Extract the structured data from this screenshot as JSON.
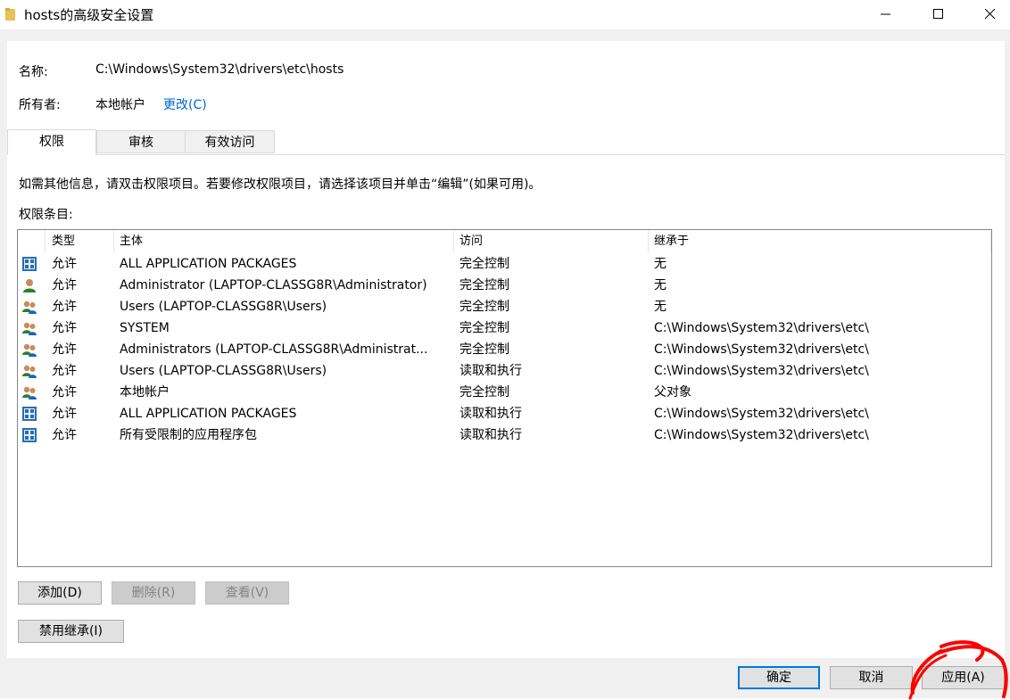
{
  "window": {
    "title": "hosts的高级安全设置"
  },
  "name_label": "名称:",
  "name_value": "C:\\Windows\\System32\\drivers\\etc\\hosts",
  "owner_label": "所有者:",
  "owner_value": "本地帐户",
  "owner_change": "更改(C)",
  "tabs": [
    "权限",
    "审核",
    "有效访问"
  ],
  "info_text": "如需其他信息，请双击权限项目。若要修改权限项目，请选择该项目并单击“编辑”(如果可用)。",
  "entries_label": "权限条目:",
  "columns": [
    "类型",
    "主体",
    "访问",
    "继承于"
  ],
  "rows": [
    {
      "icon": "app-package-icon",
      "type": "允许",
      "principal": "ALL APPLICATION PACKAGES",
      "access": "完全控制",
      "inherited": "无"
    },
    {
      "icon": "user-icon",
      "type": "允许",
      "principal": "Administrator (LAPTOP-CLASSG8R\\Administrator)",
      "access": "完全控制",
      "inherited": "无"
    },
    {
      "icon": "group-icon",
      "type": "允许",
      "principal": "Users (LAPTOP-CLASSG8R\\Users)",
      "access": "完全控制",
      "inherited": "无"
    },
    {
      "icon": "group-icon",
      "type": "允许",
      "principal": "SYSTEM",
      "access": "完全控制",
      "inherited": "C:\\Windows\\System32\\drivers\\etc\\"
    },
    {
      "icon": "group-icon",
      "type": "允许",
      "principal": "Administrators (LAPTOP-CLASSG8R\\Administrat...",
      "access": "完全控制",
      "inherited": "C:\\Windows\\System32\\drivers\\etc\\"
    },
    {
      "icon": "group-icon",
      "type": "允许",
      "principal": "Users (LAPTOP-CLASSG8R\\Users)",
      "access": "读取和执行",
      "inherited": "C:\\Windows\\System32\\drivers\\etc\\"
    },
    {
      "icon": "group-icon",
      "type": "允许",
      "principal": "本地帐户",
      "access": "完全控制",
      "inherited": "父对象"
    },
    {
      "icon": "app-package-icon",
      "type": "允许",
      "principal": "ALL APPLICATION PACKAGES",
      "access": "读取和执行",
      "inherited": "C:\\Windows\\System32\\drivers\\etc\\"
    },
    {
      "icon": "app-package-icon",
      "type": "允许",
      "principal": "所有受限制的应用程序包",
      "access": "读取和执行",
      "inherited": "C:\\Windows\\System32\\drivers\\etc\\"
    }
  ],
  "buttons": {
    "add": "添加(D)",
    "remove": "删除(R)",
    "view": "查看(V)",
    "disable_inheritance": "禁用继承(I)",
    "ok": "确定",
    "cancel": "取消",
    "apply": "应用(A)"
  },
  "colors": {
    "link": "#0066cc",
    "focus": "#0078d7",
    "annotation": "#ff0000"
  }
}
